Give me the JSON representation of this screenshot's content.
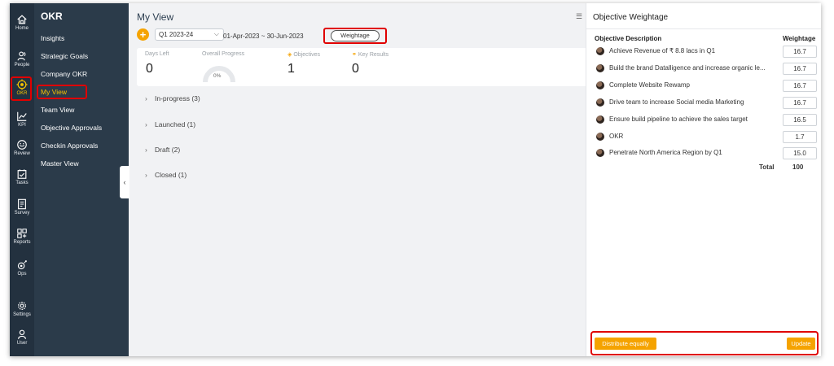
{
  "rail": [
    {
      "label": "Home",
      "icon": "home-icon"
    },
    {
      "label": "People",
      "icon": "people-icon"
    },
    {
      "label": "OKR",
      "icon": "okr-target-icon",
      "active": true
    },
    {
      "label": "KPI",
      "icon": "kpi-chart-icon"
    },
    {
      "label": "Review",
      "icon": "review-icon"
    },
    {
      "label": "Tasks",
      "icon": "tasks-icon"
    },
    {
      "label": "Survey",
      "icon": "survey-icon"
    },
    {
      "label": "Reports",
      "icon": "reports-icon"
    },
    {
      "label": "Ops",
      "icon": "ops-icon"
    },
    {
      "label": "Settings",
      "icon": "settings-gear-icon"
    },
    {
      "label": "User",
      "icon": "user-icon"
    }
  ],
  "subnav": {
    "title": "OKR",
    "items": [
      "Insights",
      "Strategic Goals",
      "Company OKR",
      "My View",
      "Team View",
      "Objective Approvals",
      "Checkin Approvals",
      "Master View"
    ],
    "active_index": 3
  },
  "main": {
    "title": "My View",
    "period": "Q1 2023-24",
    "date_range": "01-Apr-2023 ~ 30-Jun-2023",
    "weightage_button": "Weightage",
    "stats": {
      "days_left_label": "Days Left",
      "days_left": "0",
      "overall_progress_label": "Overall Progress",
      "overall_progress": "0%",
      "objectives_label": "Objectives",
      "objectives": "1",
      "key_results_label": "Key Results",
      "key_results": "0"
    },
    "sections": [
      "In-progress (3)",
      "Launched (1)",
      "Draft (2)",
      "Closed (1)"
    ]
  },
  "panel": {
    "title": "Objective Weightage",
    "col_description": "Objective Description",
    "col_weightage": "Weightage",
    "rows": [
      {
        "desc": "Achieve Revenue of ₹ 8.8 lacs in Q1",
        "weight": "16.7"
      },
      {
        "desc": "Build the brand Datalligence and increase organic le...",
        "weight": "16.7"
      },
      {
        "desc": "Complete Website Rewamp",
        "weight": "16.7"
      },
      {
        "desc": "Drive team to increase Social media Marketing",
        "weight": "16.7"
      },
      {
        "desc": "Ensure build pipeline to achieve the sales target",
        "weight": "16.5"
      },
      {
        "desc": "OKR",
        "weight": "1.7"
      },
      {
        "desc": "Penetrate North America Region by Q1",
        "weight": "15.0"
      }
    ],
    "total_label": "Total",
    "total_value": "100",
    "distribute_button": "Distribute equally",
    "update_button": "Update"
  },
  "colors": {
    "accent": "#f5a300",
    "highlight": "#e00000",
    "rail": "#23313f",
    "subnav": "#2b3b4a",
    "active_text": "#f6c200"
  }
}
